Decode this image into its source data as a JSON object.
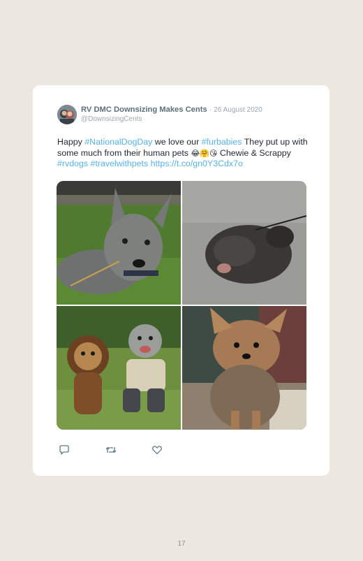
{
  "tweet": {
    "author_name": "RV DMC Downsizing Makes Cents",
    "separator": "·",
    "date": "26 August 2020",
    "handle": "@DownsizingCents",
    "text_parts": {
      "t1": "Happy ",
      "tag1": "#NationalDogDay",
      "t2": " we love our ",
      "tag2": "#furbabies",
      "t3": " They put up with some much from their human pets ",
      "emoji": "😂🤗😘",
      "t4": " Chewie & Scrappy ",
      "tag3": "#rvdogs",
      "t5": " ",
      "tag4": "#travelwithpets",
      "t6": " ",
      "link": "https://t.co/gn0Y3Cdx7o"
    },
    "actions": [
      "reply-icon",
      "retweet-icon",
      "like-icon"
    ]
  },
  "colors": {
    "background": "#ece8df",
    "card": "#ffffff",
    "name": "#5d6f78",
    "muted": "#9aa8b0",
    "link": "#57b2e8"
  },
  "page_number": "17"
}
